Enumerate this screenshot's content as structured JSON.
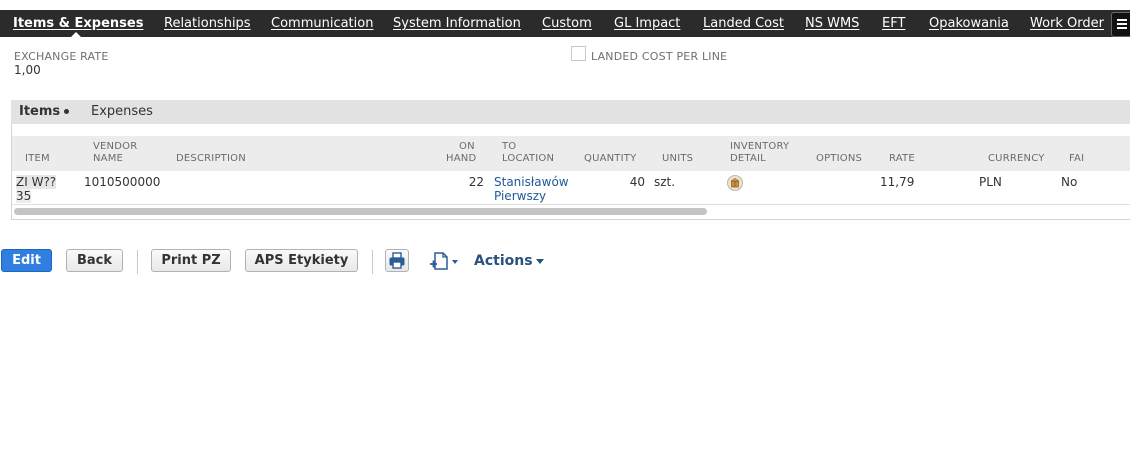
{
  "tabs": [
    {
      "label": "Items & Expenses",
      "active": true
    },
    {
      "label": "Relationships"
    },
    {
      "label": "Communication"
    },
    {
      "label": "System Information"
    },
    {
      "label": "Custom"
    },
    {
      "label": "GL Impact"
    },
    {
      "label": "Landed Cost"
    },
    {
      "label": "NS WMS"
    },
    {
      "label": "EFT"
    },
    {
      "label": "Opakowania"
    },
    {
      "label": "Work Order"
    }
  ],
  "fields": {
    "exchange_rate_label": "EXCHANGE RATE",
    "exchange_rate_value": "1,00",
    "landed_cost_per_line_label": "LANDED COST PER LINE",
    "landed_cost_per_line_checked": false
  },
  "subtabs": [
    {
      "label": "Items",
      "active": true
    },
    {
      "label": "Expenses"
    }
  ],
  "table": {
    "headers": {
      "item": "ITEM",
      "vendor_name_1": "VENDOR",
      "vendor_name_2": "NAME",
      "description": "DESCRIPTION",
      "on_hand_1": "ON",
      "on_hand_2": "HAND",
      "to_location_1": "TO",
      "to_location_2": "LOCATION",
      "quantity": "QUANTITY",
      "units": "UNITS",
      "inventory_detail_1": "INVENTORY",
      "inventory_detail_2": "DETAIL",
      "options": "OPTIONS",
      "rate": "RATE",
      "currency": "CURRENCY",
      "fai": "FAI"
    },
    "rows": [
      {
        "item_line1": "ZI W??",
        "item_line2": "35",
        "vendor_name": "1010500000",
        "description": "",
        "on_hand": "22",
        "to_location_line1": "Stanisławów",
        "to_location_line2": "Pierwszy",
        "quantity": "40",
        "units": "szt.",
        "inventory_detail_icon": "inventory-detail-icon",
        "options": "",
        "rate": "11,79",
        "currency": "PLN",
        "fai": "No"
      }
    ]
  },
  "buttons": {
    "edit": "Edit",
    "back": "Back",
    "print_pz": "Print PZ",
    "aps_etykiety": "APS Etykiety",
    "actions": "Actions"
  },
  "icons": {
    "print": "printer-icon",
    "new_document": "new-document-icon",
    "menu": "menu-icon"
  },
  "colors": {
    "topbar_bg": "#2b2b2b",
    "primary_button": "#2f7ee0",
    "link": "#1f5a96",
    "actions_text": "#28517d"
  }
}
